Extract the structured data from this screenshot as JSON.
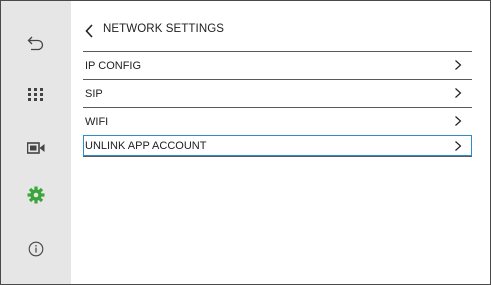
{
  "header": {
    "title": "NETWORK SETTINGS"
  },
  "menu": {
    "items": [
      {
        "label": "IP CONFIG"
      },
      {
        "label": "SIP"
      },
      {
        "label": "WIFI"
      },
      {
        "label": "UNLINK APP ACCOUNT",
        "selected": true
      }
    ]
  },
  "sidebar": {
    "icons": [
      "return-icon",
      "grid-icon",
      "camera-icon",
      "gear-icon",
      "info-icon"
    ]
  },
  "colors": {
    "sidebar_bg": "#e6e6e6",
    "accent_green": "#3aa53a",
    "selection": "#2c8ecb"
  }
}
